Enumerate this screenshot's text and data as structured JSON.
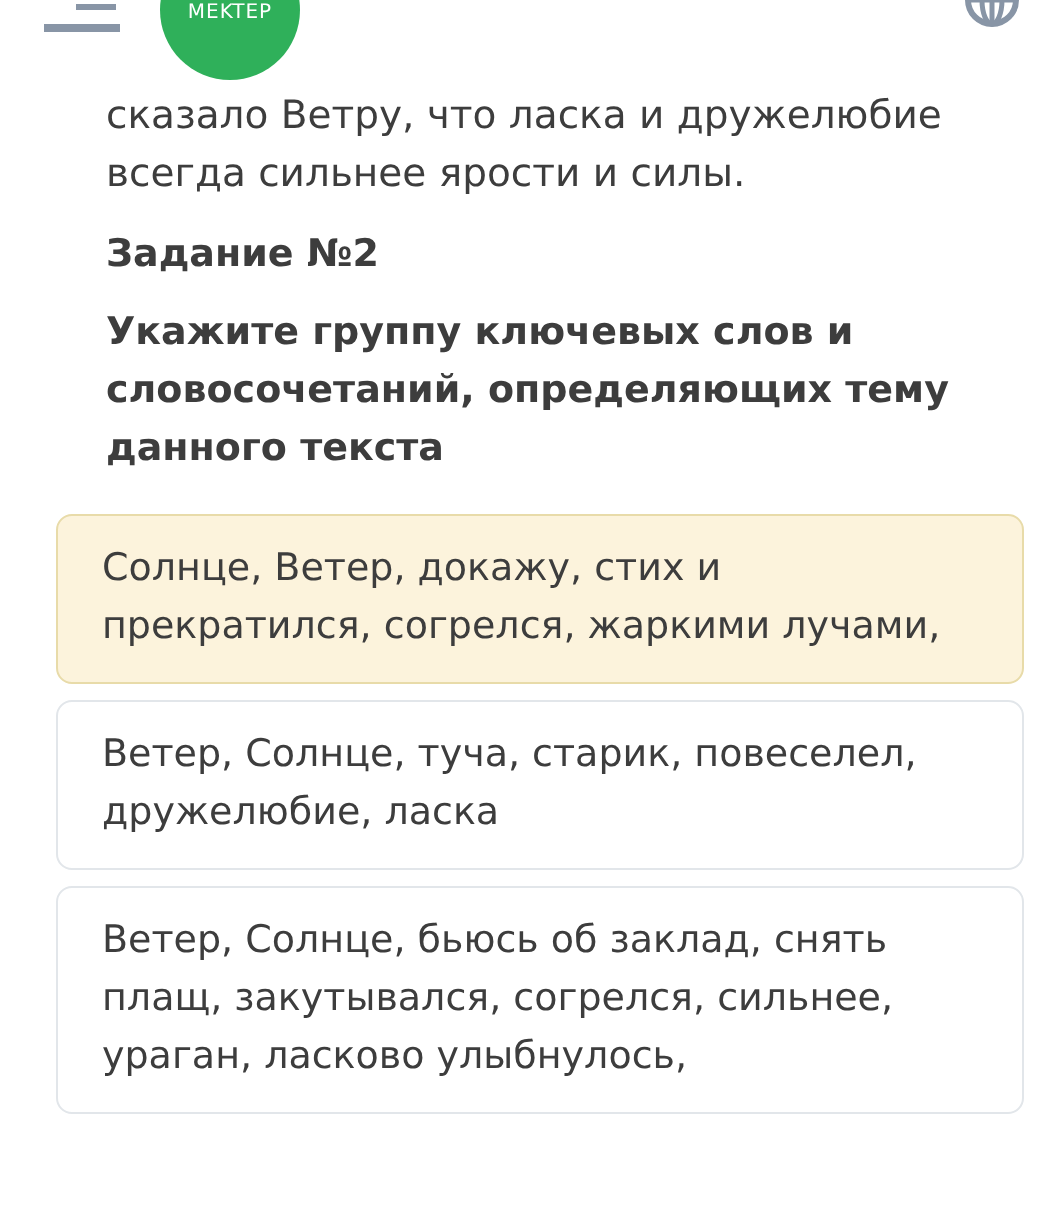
{
  "header": {
    "logo": "MEKTEP"
  },
  "passage_end": "сказало Ветру, что ласка и дружелюбие всегда сильнее ярости и силы.",
  "task": {
    "title": "Задание №2",
    "question": "Укажите группу ключевых слов и словосочетаний, определяющих тему данного текста"
  },
  "options": [
    {
      "text": "Солнце, Ветер, докажу, стих и прекратился, согрелся, жаркими лучами,",
      "selected": true
    },
    {
      "text": "Ветер, Солнце, туча, старик, повеселел, дружелюбие, ласка",
      "selected": false
    },
    {
      "text": "Ветер, Солнце, бьюсь об заклад, снять плащ, закутывался, согрелся, сильнее, ураган, ласково улыбнулось,",
      "selected": false
    }
  ]
}
